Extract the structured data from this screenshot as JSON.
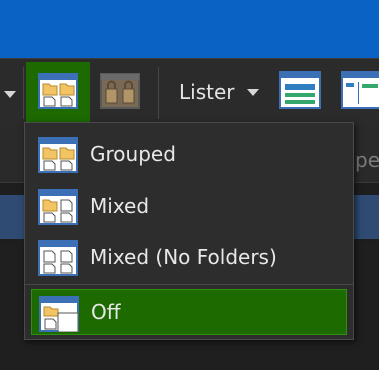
{
  "toolbar": {
    "lister_label": "Lister",
    "buttons": [
      {
        "icon": "folder-grid-icon",
        "active": true
      },
      {
        "icon": "lock-icon",
        "active": false
      },
      {
        "icon": "lister-layout-horizontal-icon",
        "active": false
      },
      {
        "icon": "lister-layout-vertical-icon",
        "active": false
      }
    ]
  },
  "background": {
    "partial_text": "pe"
  },
  "menu": {
    "items": [
      {
        "label": "Grouped",
        "icon": "grouped-icon",
        "selected": false
      },
      {
        "label": "Mixed",
        "icon": "mixed-icon",
        "selected": false
      },
      {
        "label": "Mixed (No Folders)",
        "icon": "mixed-no-folders-icon",
        "selected": false
      },
      {
        "label": "Off",
        "icon": "off-icon",
        "selected": true
      }
    ]
  },
  "colors": {
    "accent_green": "#1d6a00",
    "title_blue": "#0a62c4",
    "folder_yellow": "#f2c463",
    "window_blue": "#3b6fb6"
  }
}
